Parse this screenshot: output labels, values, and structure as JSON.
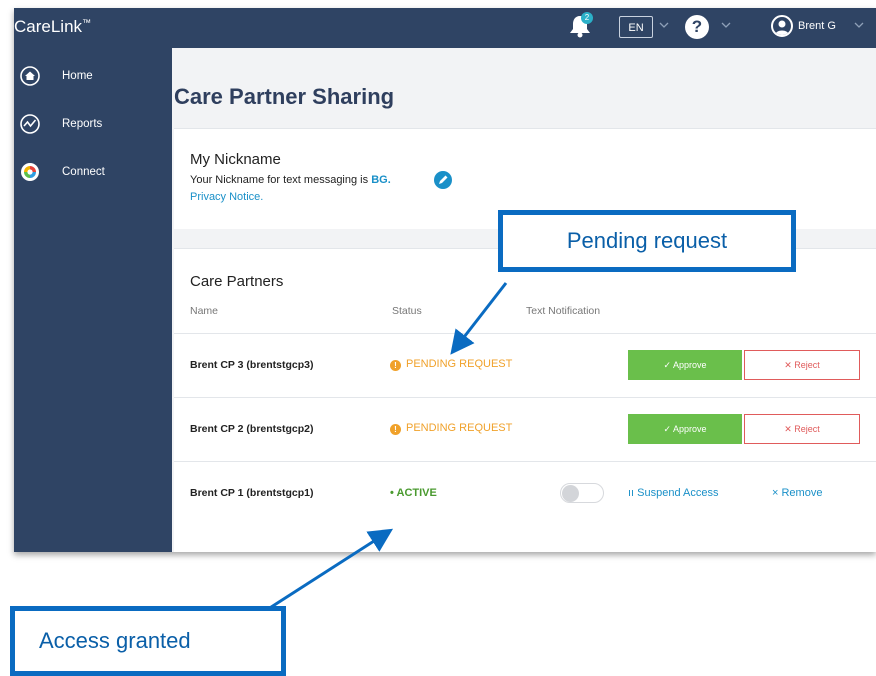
{
  "app": {
    "name": "CareLink",
    "trademark": "™"
  },
  "topbar": {
    "notification_count": "2",
    "language": "EN",
    "help_glyph": "?",
    "user_name": "Brent G"
  },
  "sidebar": {
    "items": [
      {
        "label": "Home",
        "icon": "home-icon"
      },
      {
        "label": "Reports",
        "icon": "reports-icon"
      },
      {
        "label": "Connect",
        "icon": "connect-icon"
      }
    ]
  },
  "page": {
    "title": "Care Partner Sharing"
  },
  "nickname": {
    "title": "My Nickname",
    "text_prefix": "Your Nickname for text messaging is",
    "code": "BG.",
    "privacy_link": "Privacy Notice."
  },
  "care_partners": {
    "title": "Care Partners",
    "columns": {
      "name": "Name",
      "status": "Status",
      "text_notification": "Text Notification"
    },
    "rows": [
      {
        "name": "Brent CP 3 (brentstgcp3)",
        "status": "PENDING REQUEST",
        "approve": "Approve",
        "reject": "Reject"
      },
      {
        "name": "Brent CP 2 (brentstgcp2)",
        "status": "PENDING REQUEST",
        "approve": "Approve",
        "reject": "Reject"
      },
      {
        "name": "Brent CP 1 (brentstgcp1)",
        "status": "ACTIVE",
        "suspend": "Suspend Access",
        "remove": "Remove",
        "text_notification_on": false
      }
    ]
  },
  "annotations": {
    "pending": "Pending request",
    "access": "Access granted"
  },
  "colors": {
    "navy": "#2f4464",
    "pending": "#f0a12a",
    "active": "#4a9a2f",
    "approve": "#6abf4b",
    "reject": "#e05b5b",
    "link": "#1a90c8",
    "callout_border": "#0a6bc1"
  }
}
